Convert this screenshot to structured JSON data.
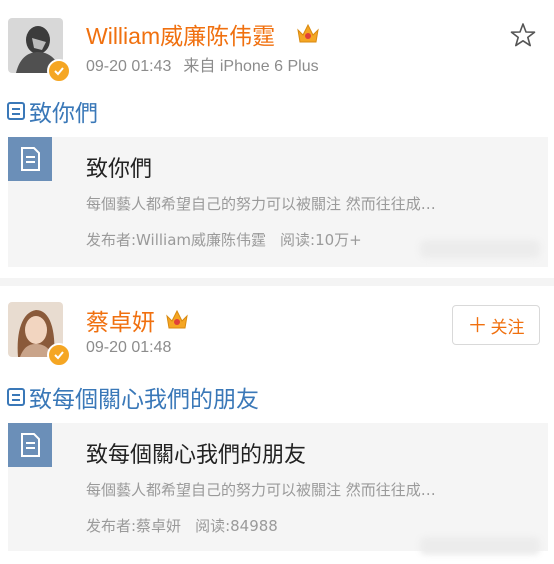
{
  "posts": [
    {
      "author": "William威廉陈伟霆",
      "time": "09-20 01:43",
      "source": "来自 iPhone 6 Plus",
      "text": "致你們",
      "card": {
        "title": "致你們",
        "excerpt": "每個藝人都希望自己的努力可以被關注 然而往往成…",
        "publisher": "发布者:William威廉陈伟霆",
        "reads": "阅读:10万+"
      }
    },
    {
      "author": "蔡卓妍",
      "time": "09-20 01:48",
      "follow_label": "关注",
      "text": "致每個關心我們的朋友",
      "card": {
        "title": "致每個關心我們的朋友",
        "excerpt": "每個藝人都希望自己的努力可以被關注 然而往往成…",
        "publisher": "发布者:蔡卓妍",
        "reads": "阅读:84988"
      }
    }
  ],
  "colors": {
    "name": "#f0700f",
    "link": "#3a78b8",
    "meta": "#8c8c8c",
    "card_bg": "#f5f5f5",
    "card_icon_bg": "#6b8fb8",
    "verified": "#f5a623"
  },
  "icons": [
    "verified-badge-icon",
    "crown-icon",
    "star-icon",
    "document-icon",
    "plus-icon"
  ]
}
